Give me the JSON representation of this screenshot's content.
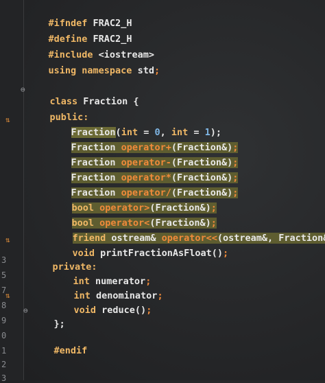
{
  "gutter": {
    "line_numbers": [
      "3",
      "5",
      "7",
      "8",
      "9",
      "0",
      "1",
      "2",
      "3"
    ]
  },
  "code": {
    "l1_a": "#ifndef",
    "l1_b": " FRAC2_H",
    "l2_a": "#define",
    "l2_b": " FRAC2_H",
    "l3_a": "#include",
    "l3_b": " <iostream>",
    "l4_a": "using namespace",
    "l4_b": " std",
    "l4_c": ";",
    "l5_a": "class",
    "l5_b": " Fraction {",
    "l6_a": "public:",
    "l7_a": "Fraction",
    "l7_b": "(",
    "l7_c": "int",
    "l7_d": " = ",
    "l7_e": "0",
    "l7_f": ", ",
    "l7_g": "int",
    "l7_h": " = ",
    "l7_i": "1",
    "l7_j": ");",
    "l8_a": "Fraction ",
    "l8_b": "operator+",
    "l8_c": "(Fraction&)",
    "l8_d": ";",
    "l9_a": "Fraction ",
    "l9_b": "operator-",
    "l9_c": "(Fraction&)",
    "l9_d": ";",
    "l10_a": "Fraction ",
    "l10_b": "operator*",
    "l10_c": "(Fraction&)",
    "l10_d": ";",
    "l11_a": "Fraction ",
    "l11_b": "operator/",
    "l11_c": "(Fraction&)",
    "l11_d": ";",
    "l12_a": "bool ",
    "l12_b": "operator>",
    "l12_c": "(Fraction&)",
    "l12_d": ";",
    "l13_a": "bool ",
    "l13_b": "operator<",
    "l13_c": "(Fraction&)",
    "l13_d": ";",
    "l14_a": "friend",
    "l14_b": " ostream& ",
    "l14_c": "operator<<",
    "l14_d": "(ostream&, Fraction&)",
    "l14_e": ";",
    "l15_a": "void",
    "l15_b": " printFractionAsFloat()",
    "l15_c": ";",
    "l16_a": "private:",
    "l17_a": "int",
    "l17_b": " numerator",
    "l17_c": ";",
    "l18_a": "int",
    "l18_b": " denominator",
    "l18_c": ";",
    "l19_a": "void",
    "l19_b": " reduce()",
    "l19_c": ";",
    "l20_a": "};",
    "l21_a": "#endif"
  },
  "colors": {
    "background": "#262729",
    "keyword": "#f0b866",
    "operator": "#f08a3a",
    "number": "#7fb7e6",
    "highlight": "#6b6a35",
    "text": "#e8e8e8"
  }
}
